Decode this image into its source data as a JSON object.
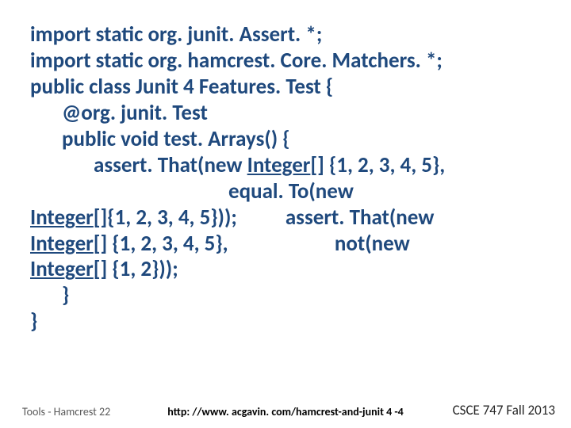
{
  "code": {
    "l1": "import static org. junit. Assert. *;",
    "l2": "import static org. hamcrest. Core. Matchers. *;",
    "l3": "public class Junit 4 Features. Test {",
    "l4": "@org. junit. Test",
    "l5": "public void test. Arrays() {",
    "l6a": "assert. That(new ",
    "l6b": "Integer",
    "l6c": "[] {1, 2, 3, 4, 5},",
    "l7": "equal. To(new",
    "l8a": "Integer",
    "l8b": "[]{1, 2, 3, 4, 5}));          assert. That(new",
    "l9a": "Integer",
    "l9b": "[] {1, 2, 3, 4, 5},                      not(new",
    "l10a": "Integer",
    "l10b": "[] {1, 2}));",
    "l11": "}",
    "l12": "}"
  },
  "footer": {
    "left": "Tools - Hamcrest  22",
    "center": "http: //www. acgavin. com/hamcrest-and-junit 4 -4",
    "right": "CSCE 747 Fall 2013"
  }
}
